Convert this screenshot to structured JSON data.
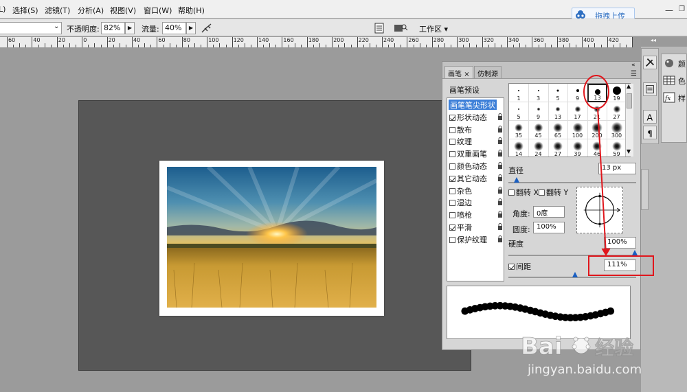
{
  "menu": {
    "items": [
      "L)",
      "选择(S)",
      "滤镜(T)",
      "分析(A)",
      "视图(V)",
      "窗口(W)",
      "帮助(H)"
    ]
  },
  "upload": {
    "label": "拖拽上传"
  },
  "options": {
    "opacity_label": "不透明度:",
    "opacity_value": "82%",
    "flow_label": "流量:",
    "flow_value": "40%",
    "workspace_label": "工作区 ▾"
  },
  "ruler": {
    "labels": [
      "60",
      "40",
      "20",
      "0",
      "20",
      "40",
      "60",
      "80",
      "100",
      "120",
      "140",
      "160",
      "180",
      "200",
      "220",
      "240",
      "260",
      "280",
      "300",
      "320",
      "340",
      "360",
      "380",
      "400",
      "420",
      "440"
    ]
  },
  "brush_panel": {
    "tabs": [
      "画笔",
      "仿制源"
    ],
    "preset_header": "画笔预设",
    "options": [
      {
        "label": "画笔笔尖形状",
        "checkbox": false,
        "checked": false,
        "selected": true
      },
      {
        "label": "形状动态",
        "checkbox": true,
        "checked": true,
        "lock": true
      },
      {
        "label": "散布",
        "checkbox": true,
        "checked": false,
        "lock": true
      },
      {
        "label": "纹理",
        "checkbox": true,
        "checked": false,
        "lock": true
      },
      {
        "label": "双重画笔",
        "checkbox": true,
        "checked": false,
        "lock": true
      },
      {
        "label": "颜色动态",
        "checkbox": true,
        "checked": false,
        "lock": true
      },
      {
        "label": "其它动态",
        "checkbox": true,
        "checked": true,
        "lock": true
      },
      {
        "label": "杂色",
        "checkbox": true,
        "checked": false,
        "lock": true
      },
      {
        "label": "湿边",
        "checkbox": true,
        "checked": false,
        "lock": true
      },
      {
        "label": "喷枪",
        "checkbox": true,
        "checked": false,
        "lock": true
      },
      {
        "label": "平滑",
        "checkbox": true,
        "checked": true,
        "lock": true
      },
      {
        "label": "保护纹理",
        "checkbox": true,
        "checked": false,
        "lock": true
      }
    ],
    "tips": [
      {
        "size": "1"
      },
      {
        "size": "3"
      },
      {
        "size": "5"
      },
      {
        "size": "9"
      },
      {
        "size": "13"
      },
      {
        "size": "19"
      },
      {
        "size": "5"
      },
      {
        "size": "9"
      },
      {
        "size": "13"
      },
      {
        "size": "17"
      },
      {
        "size": "21"
      },
      {
        "size": "27"
      },
      {
        "size": "35"
      },
      {
        "size": "45"
      },
      {
        "size": "65"
      },
      {
        "size": "100"
      },
      {
        "size": "200"
      },
      {
        "size": "300"
      },
      {
        "size": "14"
      },
      {
        "size": "24"
      },
      {
        "size": "27"
      },
      {
        "size": "39"
      },
      {
        "size": "46"
      },
      {
        "size": "59"
      }
    ],
    "selected_tip": "13",
    "diameter_label": "直径",
    "diameter_value": "13 px",
    "flip_x": "翻转 X",
    "flip_y": "翻转 Y",
    "angle_label": "角度:",
    "angle_value": "0度",
    "roundness_label": "圆度:",
    "roundness_value": "100%",
    "hardness_label": "硬度",
    "hardness_value": "100%",
    "spacing_label": "间距",
    "spacing_value": "111%",
    "spacing_checked": true
  },
  "dock": {
    "labels": [
      "颜",
      "色",
      "样"
    ]
  },
  "watermark": {
    "text": "jingyan.baidu.com"
  },
  "colors": {
    "accent": "#e0161c",
    "selection": "#3c7fd8",
    "upload_blue": "#2e6fc2"
  }
}
